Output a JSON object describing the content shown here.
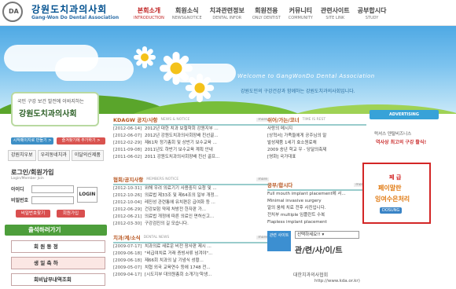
{
  "header": {
    "logo_text": "DA",
    "brand_ko": "강원도치과의사회",
    "brand_en": "Gang-Won Do Dental Association",
    "nav": [
      {
        "ko": "본회소개",
        "en": "INTRODUCTION"
      },
      {
        "ko": "회원소식",
        "en": "NEWS&NOTICE"
      },
      {
        "ko": "치과관련정보",
        "en": "DENTAL INFOR"
      },
      {
        "ko": "회원전용",
        "en": "ONLY DENTIST"
      },
      {
        "ko": "커뮤니티",
        "en": "COMMUNITY"
      },
      {
        "ko": "관련사이트",
        "en": "SITE LINK"
      },
      {
        "ko": "공부합시다",
        "en": "STUDY"
      }
    ]
  },
  "hero": {
    "welcome": "Welcome to GangWonDo Dental Association",
    "subtitle": "강원도민의 구강건강과 함께하는 강원도치과의사회입니다."
  },
  "left": {
    "promo_line1": "국민 구강 보건 발전에 이바지하는",
    "promo_line2": "강원도치과의사회",
    "chip1": "시작페이지로 만들기 >",
    "chip2": "즐겨찾기에 추가하기 >",
    "tabs": [
      "강원치우보",
      "우리동네치과",
      "이달의신제품"
    ],
    "login_title": "로그인/회원가입",
    "login_sub": "Login/Member Join",
    "id_label": "아이디",
    "pw_label": "비밀번호",
    "login_button": "LOGIN",
    "find_pw": "비밀번호찾기",
    "join": "회원가입",
    "check_bar": "출석하러가기",
    "side_buttons": [
      "회 원 동 정",
      "생 일 축 하",
      "회비납부내역조회"
    ]
  },
  "boards": {
    "kdaw": {
      "title": "KDAGW 공지/사항",
      "en": "NEWS & NOTICE",
      "more": "more",
      "rows": [
        {
          "d": "[2012-06-14]",
          "s": "2012년 대한 치과 보철학회 강원지부 ..."
        },
        {
          "d": "[2012-06-07]",
          "s": "2012년 강원도치과의사회장배 친선골..."
        },
        {
          "d": "[2012-02-29]",
          "s": "제61차 정기총회 및 상반기 보수교육 ..."
        },
        {
          "d": "[2011-09-08]",
          "s": "2011년도 하반기 보수교육 계획 안내"
        },
        {
          "d": "[2011-06-02]",
          "s": "2011 강원도치과의사회장배 친선 골프..."
        }
      ]
    },
    "member": {
      "title": "협회/공지사항",
      "en": "MEMBERS NOTICE",
      "more": "more",
      "rows": [
        {
          "d": "[2012-10-31]",
          "s": "위해 우려 의료기기 사용중지 요청 및 ..."
        },
        {
          "d": "[2012-10-26]",
          "s": "의료법 제33조 및 제64조의 일부 개정..."
        },
        {
          "d": "[2012-10-04]",
          "s": "레진성 관련통에 유치편은 급여화 등 ..."
        },
        {
          "d": "[2012-06-29]",
          "s": "건강보험 약제 처방전 한자판 가..."
        },
        {
          "d": "[2012-06-21]",
          "s": "의료법 개정에 따른 의료인 면허신고..."
        },
        {
          "d": "[2012-03-30]",
          "s": "구강검진의 길 모습니다."
        }
      ]
    },
    "dental": {
      "title": "치과/계/소식",
      "en": "DENTAL NEWS",
      "more": "more",
      "rows": [
        {
          "d": "[2009-07-17]",
          "s": "치과의료 새로운 비전 장사판 제시 ..."
        },
        {
          "d": "[2009-06-18]",
          "s": "\"비급여치료 거래 증빙서류 넘겨야\"..."
        },
        {
          "d": "[2009-06-18]",
          "s": "제66회 치과의 날 기념식 성황..."
        },
        {
          "d": "[2009-05-07]",
          "s": "치협 외국 교육연수 등에 1748 전..."
        },
        {
          "d": "[2009-04-17]",
          "s": "[시도지부 대의원총회 소개기]'학생..."
        }
      ]
    },
    "qna": {
      "title": "쉬어/가는/코너",
      "en": "TIME IS REST",
      "rows": [
        {
          "s": "사랑의 메시지"
        },
        {
          "s": "[상혁서] 가족들에게 공주님의 말"
        },
        {
          "s": "발성제품 1세기 효소원료채"
        },
        {
          "s": "2009 송년 학교 우 - 당달의축제"
        },
        {
          "s": "[영화] 국가대표"
        }
      ]
    },
    "clinic": {
      "title": "공부/합시다",
      "more": "more",
      "rows": [
        {
          "s": "Full mouth implant placement에 서..."
        },
        {
          "s": "Minimal invasive surgery"
        },
        {
          "s": "알의 움체 치료 전후 사진입니다."
        },
        {
          "s": "전치부 multiple 임플란트 수복"
        },
        {
          "s": "Flapless implant placement"
        }
      ]
    }
  },
  "right": {
    "ad_head": "ADVERTISING",
    "ad1_line1": "럭셔스 덴탈비즈니스",
    "ad1_line2": "역사상 최고의 구강 활식!",
    "box_line1": "페 급",
    "box_line2": "페이말란",
    "box_line3": "잉여수은처리",
    "box_brand": "DOSUNG",
    "select_label": "관련 사이트",
    "select_value": "선택하세요!!",
    "link_title": "관/련/사/이/트",
    "site_name": "대한치과의사협회",
    "site_url": "http://www.kda.or.kr)"
  },
  "colors": {
    "brand": "#00508f",
    "nav_active": "#c02323",
    "board_title": "#b7541e",
    "ad_border": "#d32626"
  }
}
